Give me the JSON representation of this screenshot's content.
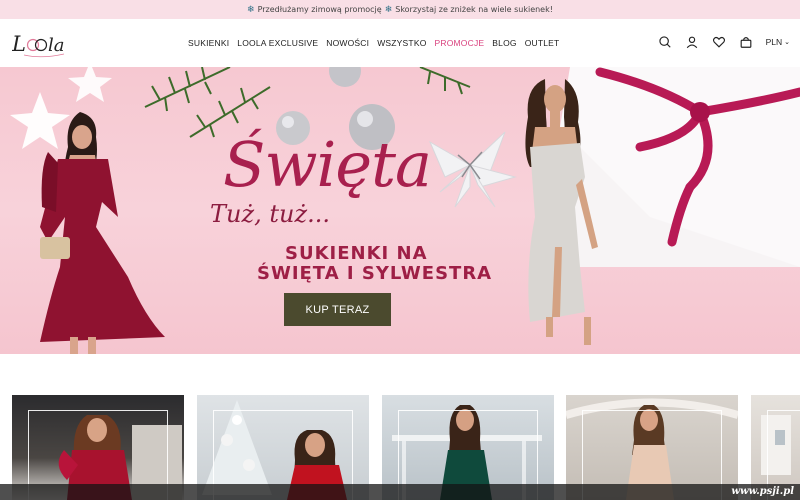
{
  "announcement": {
    "text1": "Przedłużamy zimową promocję",
    "text2": "Skorzystaj ze zniżek na wiele sukienek!"
  },
  "logo": {
    "text": "Loola"
  },
  "nav": {
    "items": [
      "SUKIENKI",
      "LOOLA EXCLUSIVE",
      "NOWOŚCI",
      "WSZYSTKO",
      "PROMOCJE",
      "BLOG",
      "OUTLET"
    ],
    "active": "PROMOCJE"
  },
  "header_icons": [
    "search-icon",
    "user-icon",
    "heart-icon",
    "bag-icon"
  ],
  "currency": {
    "label": "PLN"
  },
  "hero": {
    "title": "Święta",
    "subtitle": "Tuż, tuż...",
    "line1": "SUKIENKI NA",
    "line2": "ŚWIĘTA I SYLWESTRA",
    "cta": "KUP TERAZ"
  },
  "colors": {
    "accent": "#d9417e",
    "hero_text": "#a8204e",
    "cta_bg": "#4b4a2e",
    "announce_bg": "#f9dfe6"
  },
  "watermark": {
    "text": "www.psji.pl"
  }
}
